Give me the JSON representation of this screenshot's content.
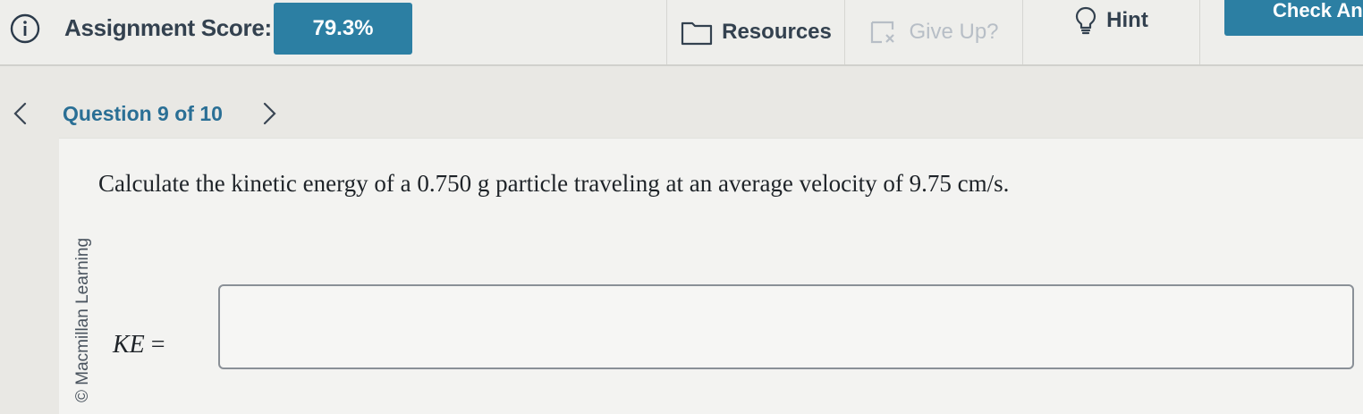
{
  "header": {
    "score_label": "Assignment Score:",
    "score_value": "79.3%",
    "tools": {
      "resources": "Resources",
      "give_up": "Give Up?",
      "hint": "Hint"
    },
    "check_answer": "Check Answer"
  },
  "nav": {
    "question_label": "Question 9 of 10"
  },
  "question": {
    "copyright": "© Macmillan Learning",
    "text": "Calculate the kinetic energy of a 0.750 g particle traveling at an average velocity of 9.75 cm/s.",
    "answer_label_var": "KE",
    "answer_label_eq": " =",
    "answer_value": ""
  },
  "colors": {
    "accent": "#2c7fa3",
    "nav_text": "#2a6f95",
    "disabled": "#b7bec6"
  }
}
